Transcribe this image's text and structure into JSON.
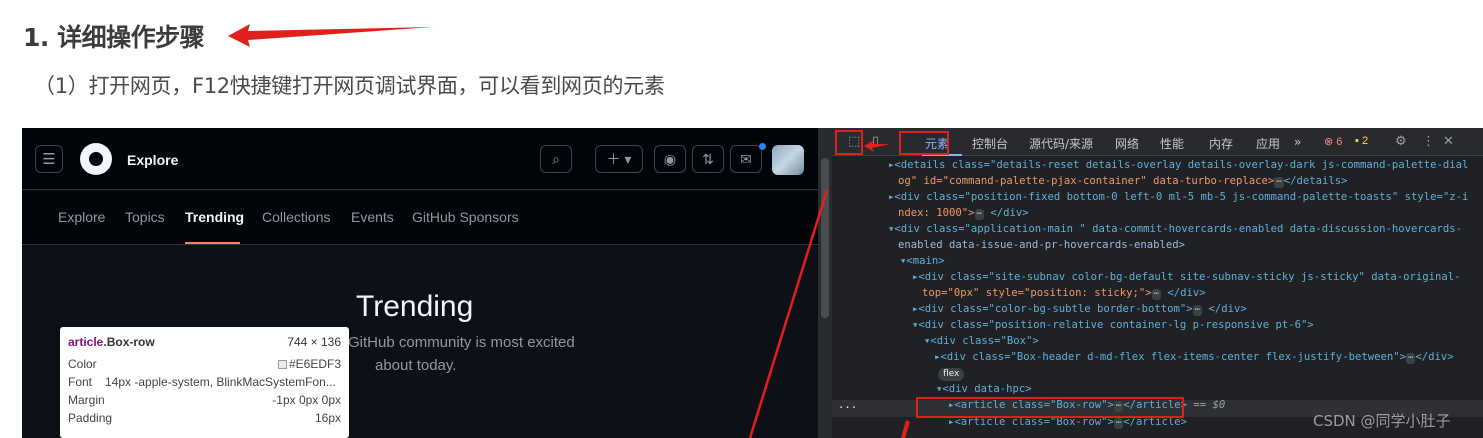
{
  "heading": "1. 详细操作步骤",
  "paragraph": "（1）打开网页，F12快捷键打开网页调试界面，可以看到网页的元素",
  "github": {
    "explore_label": "Explore",
    "nav": [
      "Explore",
      "Topics",
      "Trending",
      "Collections",
      "Events",
      "GitHub Sponsors"
    ],
    "active_nav": "Trending",
    "title": "Trending",
    "subtitle_line1": "GitHub community is most excited",
    "subtitle_line2": "about today.",
    "tooltip": {
      "tag": "article",
      "cls": ".Box-row",
      "dims": "744 × 136",
      "rows": [
        {
          "key": "Color",
          "value": "#E6EDF3"
        },
        {
          "key": "Font",
          "value": "14px -apple-system, BlinkMacSystemFon..."
        },
        {
          "key": "Margin",
          "value": "-1px 0px 0px"
        },
        {
          "key": "Padding",
          "value": "16px"
        }
      ]
    }
  },
  "devtools": {
    "tabs": [
      "元素",
      "控制台",
      "源代码/来源",
      "网络",
      "性能",
      "内存",
      "应用"
    ],
    "more": "»",
    "errors": "6",
    "warnings": "2",
    "lines": {
      "l1a": "▸<details class=\"details-reset details-overlay details-overlay-dark js-command-palette-dial",
      "l1b": "og\" id=\"command-palette-pjax-container\" data-turbo-replace>",
      "l1c": "</details>",
      "l2a": "▸<div class=\"position-fixed bottom-0 left-0 ml-5 mb-5 js-command-palette-toasts\" style=\"z-i",
      "l2b": "ndex: 1000\">",
      "l2c": "</div>",
      "l3a": "▾<div class=\"application-main \" data-commit-hovercards-enabled data-discussion-hovercards-",
      "l3b": "enabled data-issue-and-pr-hovercards-enabled>",
      "l4": "▾<main>",
      "l5a": "▸<div class=\"site-subnav color-bg-default site-subnav-sticky js-sticky\" data-original-",
      "l5b": "top=\"0px\" style=\"position: sticky;\">",
      "l5c": "</div>",
      "l6a": "▸<div class=\"color-bg-subtle border-bottom\">",
      "l6b": "</div>",
      "l7": "▾<div class=\"position-relative container-lg p-responsive pt-6\">",
      "l8": "▾<div class=\"Box\">",
      "l9a": "▸<div class=\"Box-header d-md-flex flex-items-center flex-justify-between\">",
      "l9b": "</div>",
      "flex": "flex",
      "l10": "▾<div data-hpc>",
      "ellipsis": "...",
      "l11a": "▸<article class=\"Box-row\">",
      "l11b": "</article>",
      "eq": " == $0",
      "l12a": "▸<article class=\"Box-row\">",
      "l12b": "</article>",
      "dots": "⋯"
    }
  },
  "watermark": "CSDN @同学小肚子",
  "colors": {
    "annotation_red": "#e0201b"
  }
}
